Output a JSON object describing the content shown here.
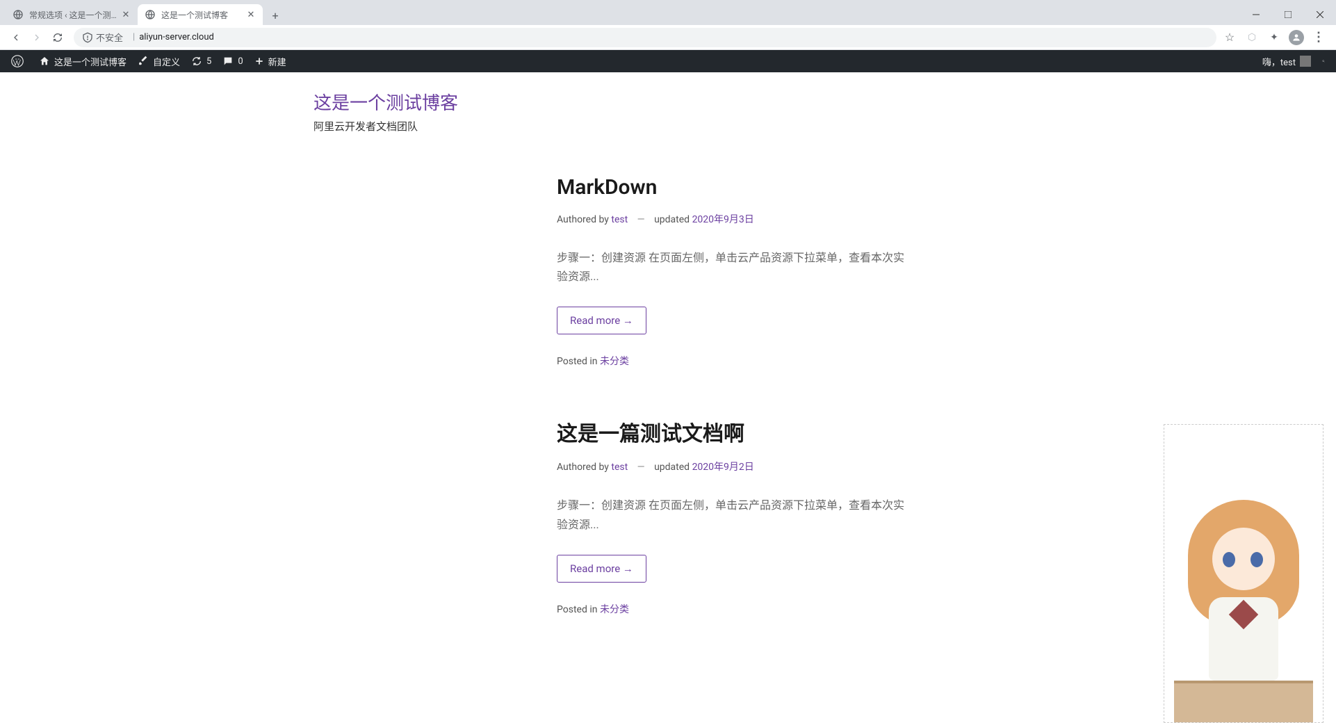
{
  "browser": {
    "tabs": [
      {
        "title": "常规选项 ‹ 这是一个测试博客 —",
        "active": false
      },
      {
        "title": "这是一个测试博客",
        "active": true
      }
    ],
    "security_label": "不安全",
    "url": "aliyun-server.cloud"
  },
  "wp_admin": {
    "site_name": "这是一个测试博客",
    "customize": "自定义",
    "updates": "5",
    "comments": "0",
    "new": "新建",
    "greeting": "嗨，test"
  },
  "site": {
    "title": "这是一个测试博客",
    "tagline": "阿里云开发者文档团队"
  },
  "posts": [
    {
      "title": "MarkDown",
      "authored_by_label": "Authored by",
      "author": "test",
      "updated_label": "updated",
      "date": "2020年9月3日",
      "excerpt": "步骤一：创建资源 在页面左侧，单击云产品资源下拉菜单，查看本次实验资源...",
      "read_more": "Read more →",
      "posted_in_label": "Posted in",
      "category": "未分类"
    },
    {
      "title": "这是一篇测试文档啊",
      "authored_by_label": "Authored by",
      "author": "test",
      "updated_label": "updated",
      "date": "2020年9月2日",
      "excerpt": "步骤一：创建资源 在页面左侧，单击云产品资源下拉菜单，查看本次实验资源...",
      "read_more": "Read more →",
      "posted_in_label": "Posted in",
      "category": "未分类"
    }
  ],
  "meta_separator": "—"
}
